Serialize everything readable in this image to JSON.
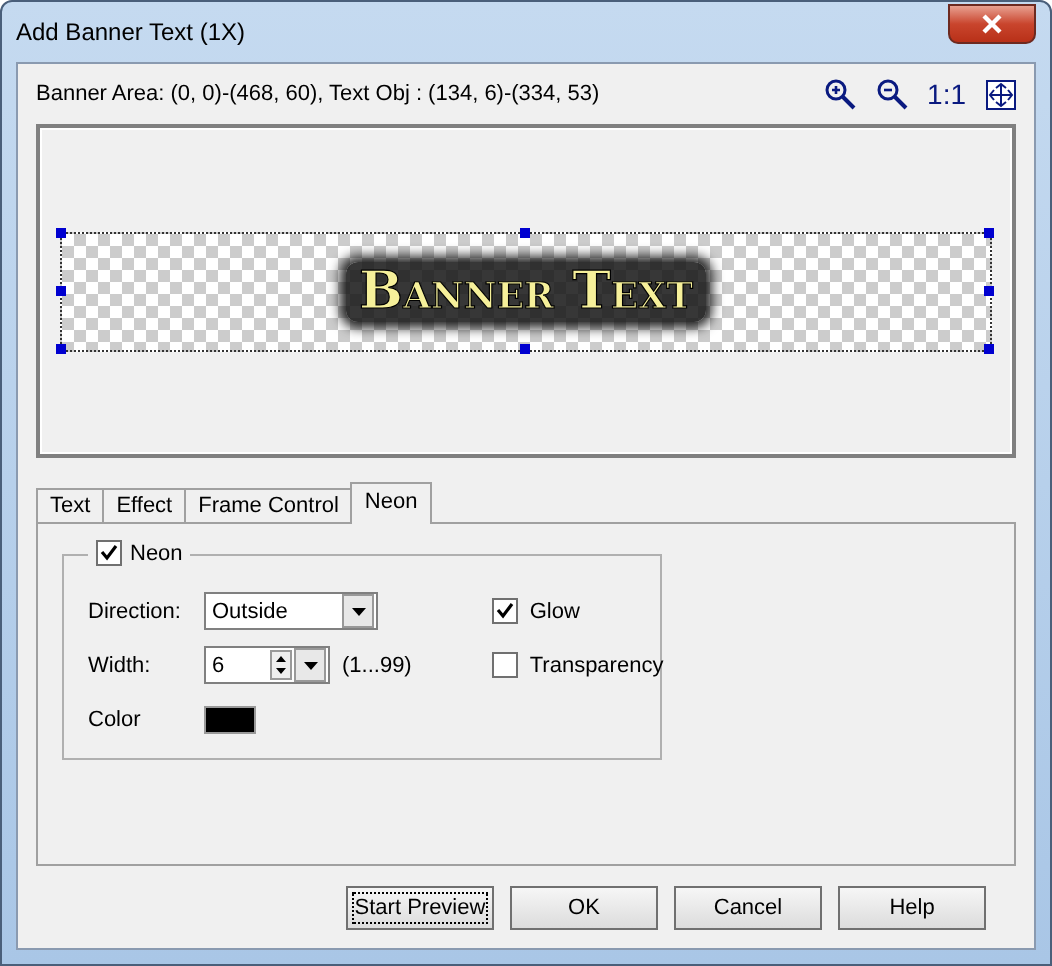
{
  "window": {
    "title": "Add Banner Text (1X)"
  },
  "info": "Banner Area: (0, 0)-(468, 60), Text Obj : (134, 6)-(334, 53)",
  "zoom_tools": [
    {
      "kind": "zoom-in"
    },
    {
      "kind": "zoom-out"
    },
    {
      "kind": "actual",
      "label": "1:1"
    },
    {
      "kind": "fit"
    }
  ],
  "preview": {
    "banner_text": "Banner Text"
  },
  "tabs": [
    {
      "label": "Text",
      "selected": false
    },
    {
      "label": "Effect",
      "selected": false
    },
    {
      "label": "Frame Control",
      "selected": false
    },
    {
      "label": "Neon",
      "selected": true
    }
  ],
  "neon": {
    "label": "Neon",
    "checked": true,
    "direction": {
      "label": "Direction:",
      "value": "Outside"
    },
    "width": {
      "label": "Width:",
      "value": "6",
      "range": "(1...99)"
    },
    "color": {
      "label": "Color",
      "color": "#000000"
    },
    "options": [
      {
        "label": "Glow",
        "checked": true
      },
      {
        "label": "Transparency",
        "checked": false
      }
    ]
  },
  "buttons": [
    {
      "label": "Start Preview",
      "focused": true
    },
    {
      "label": "OK",
      "focused": false
    },
    {
      "label": "Cancel",
      "focused": false
    },
    {
      "label": "Help",
      "focused": false
    }
  ]
}
